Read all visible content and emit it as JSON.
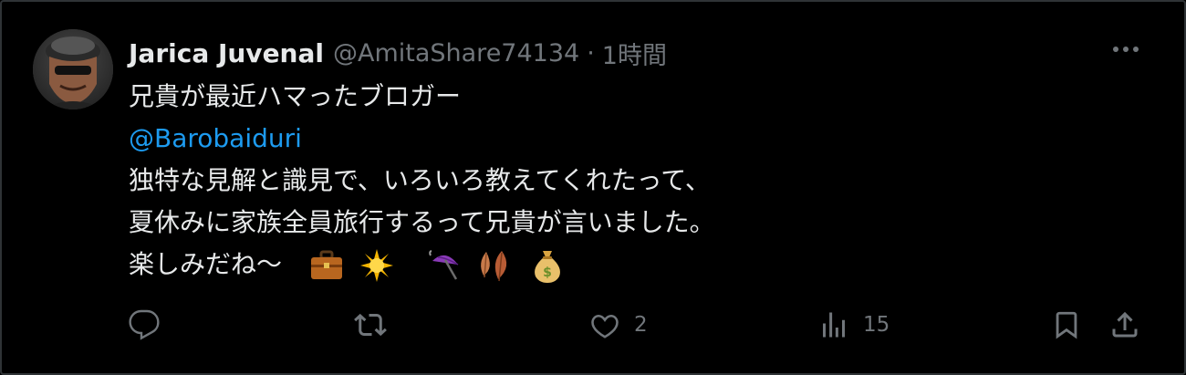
{
  "tweet": {
    "author": {
      "display_name": "Jarica Juvenal",
      "handle": "@AmitaShare74134"
    },
    "separator": "·",
    "time": "1時間",
    "text_lines": [
      "兄貴が最近ハマったブロガー",
      "@Barobaiduri",
      "独特な見解と識見で、いろいろ教えてくれたって、",
      "夏休みに家族全員旅行するって兄貴が言いました。",
      "楽しみだね〜"
    ],
    "mention": "@Barobaiduri",
    "emoji_icons": [
      "briefcase-icon",
      "sun-icon",
      "umbrella-icon",
      "leaves-icon",
      "money-bag-icon"
    ],
    "actions": {
      "reply_count": "",
      "retweet_count": "",
      "like_count": "2",
      "view_count": "15"
    }
  },
  "colors": {
    "background": "#000000",
    "text": "#e7e9ea",
    "muted": "#71767b",
    "link": "#1d9bf0",
    "border": "#2f3336"
  }
}
